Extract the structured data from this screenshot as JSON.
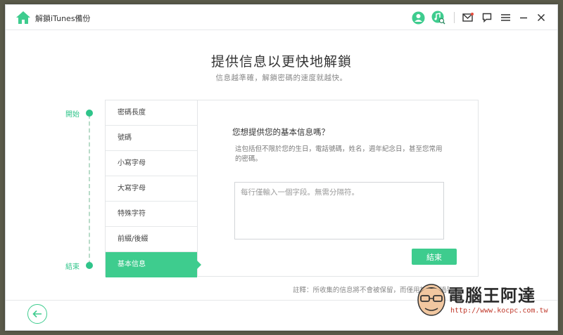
{
  "app": {
    "title": "解鎖iTunes備份"
  },
  "titlebar_icons": [
    "user-icon",
    "music-search-icon",
    "mail-icon",
    "feedback-icon",
    "menu-icon",
    "minimize-icon",
    "close-icon"
  ],
  "heading": {
    "title": "提供信息以更快地解鎖",
    "subtitle": "信息越準確，解鎖密碼的速度就越快。"
  },
  "progress": {
    "start_label": "開始",
    "end_label": "結束"
  },
  "steps": [
    {
      "label": "密碼長度"
    },
    {
      "label": "號碼"
    },
    {
      "label": "小寫字母"
    },
    {
      "label": "大寫字母"
    },
    {
      "label": "特殊字符"
    },
    {
      "label": "前綴/後綴"
    },
    {
      "label": "基本信息",
      "active": true
    }
  ],
  "question": {
    "title": "您想提供您的基本信息嗎？",
    "description": "這包括但不限於您的生日，電話號碼，姓名，週年紀念日，甚至您常用的密碼。",
    "placeholder": "每行僅輸入一個字段。無需分隔符。",
    "value": "",
    "finish_label": "結束"
  },
  "note": "註釋：所收集的信息將不會被保留，而僅用於解鎖過程。",
  "watermark": {
    "title": "電腦王阿達",
    "url": "http://www.kocpc.com.tw"
  },
  "colors": {
    "accent": "#3ecc8e",
    "rail": "#b9dcc9"
  }
}
